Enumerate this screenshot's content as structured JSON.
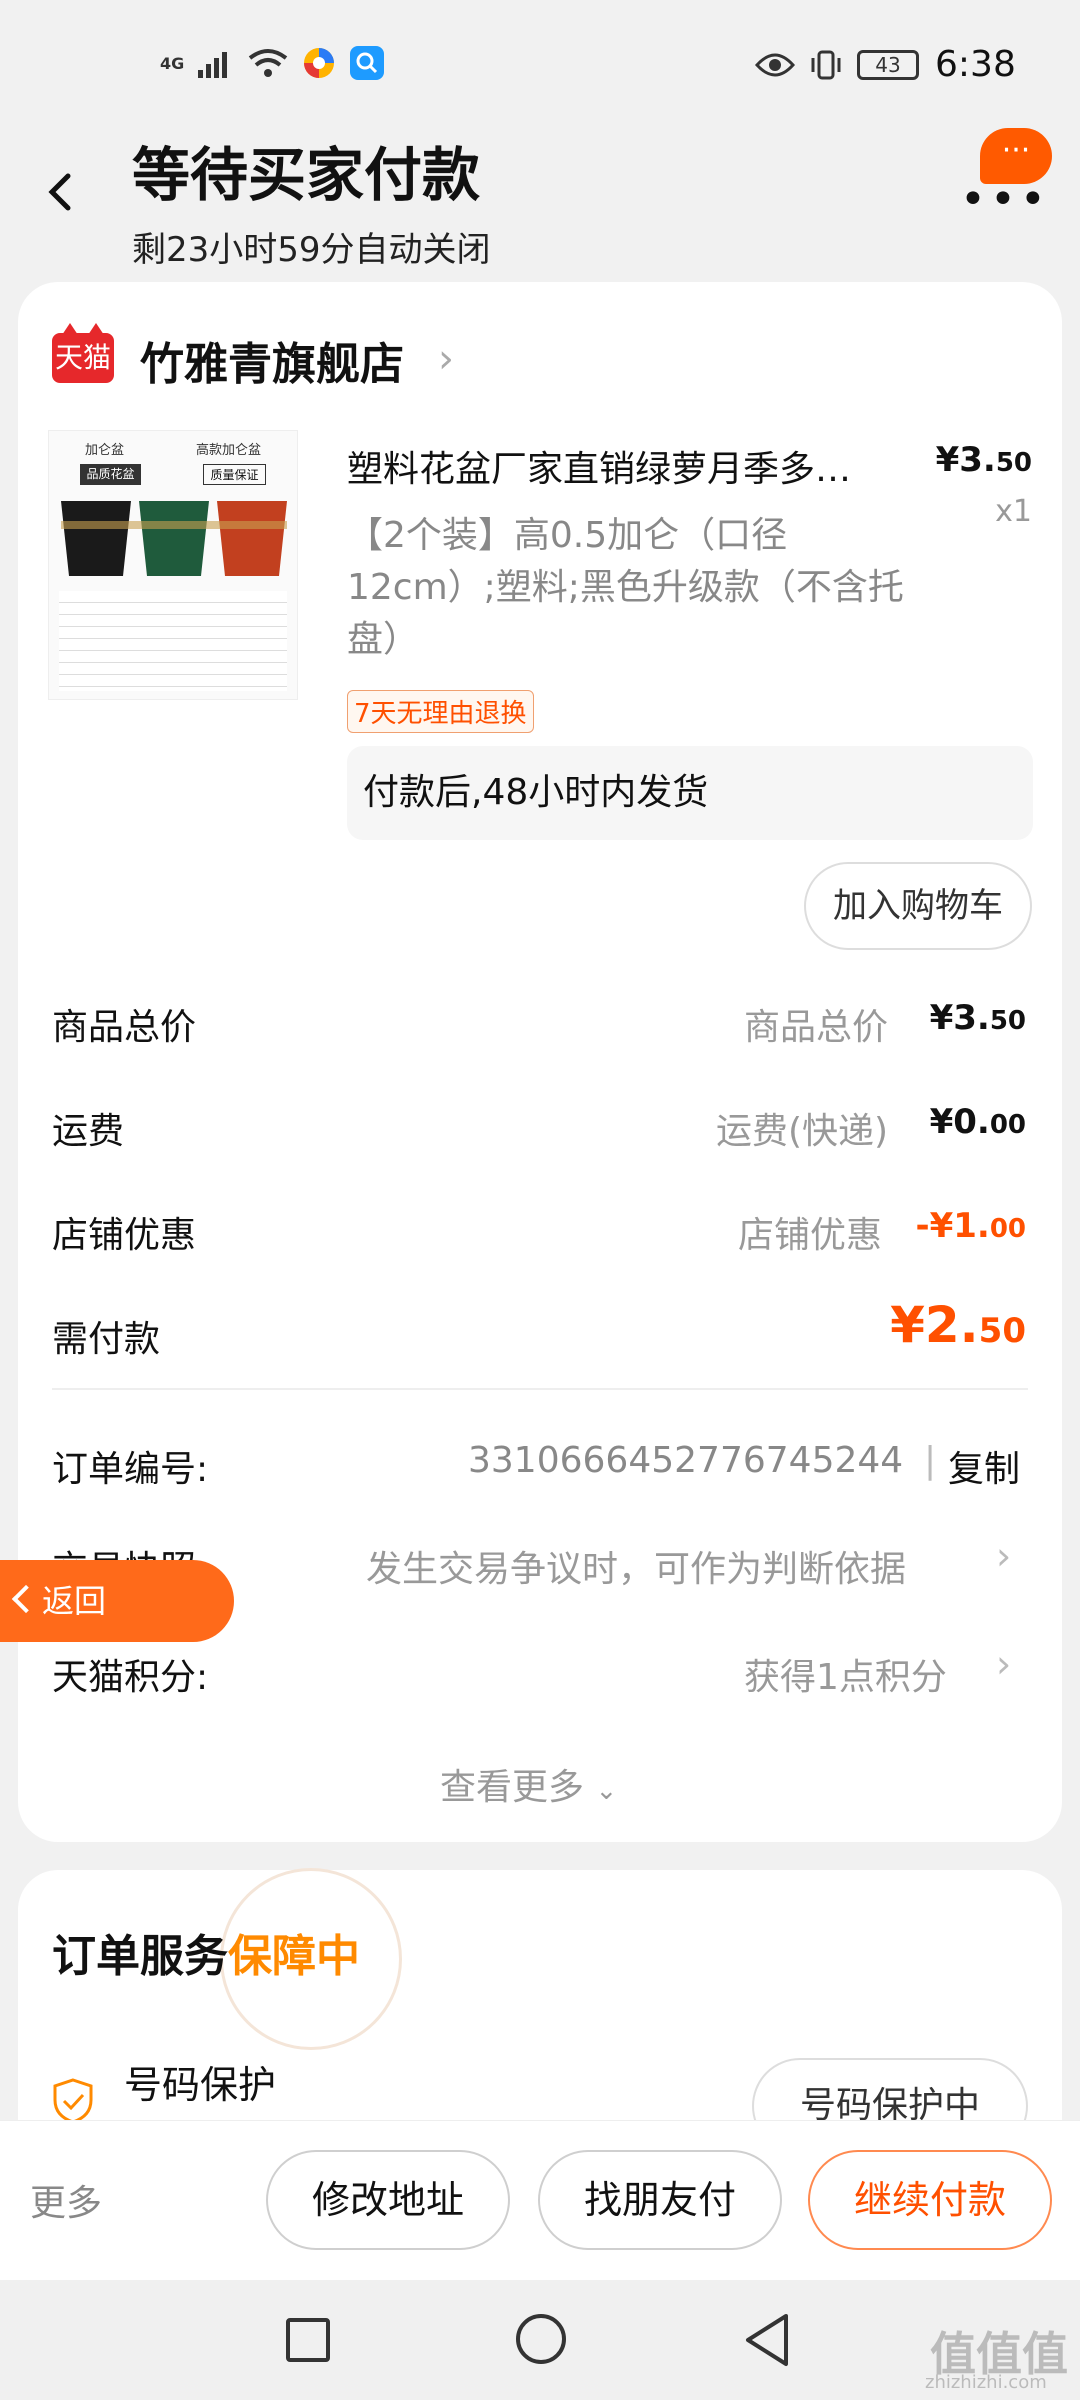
{
  "status_bar": {
    "time": "6:38",
    "battery": "43",
    "network": "4G"
  },
  "header": {
    "title": "等待买家付款",
    "subtitle": "剩23小时59分自动关闭",
    "chat_badge": "···",
    "more_label": "•••"
  },
  "shop": {
    "logo_text": "天猫",
    "name": "竹雅青旗舰店"
  },
  "product": {
    "title": "塑料花盆厂家直销绿萝月季多…",
    "price_main": "¥3.",
    "price_cents": "50",
    "quantity": "x1",
    "sku": "【2个装】高0.5加仑（口径12cm）;塑料;黑色升级款（不含托盘）",
    "tag": "7天无理由退换",
    "shipping_note": "付款后,48小时内发货",
    "add_to_cart": "加入购物车",
    "thumb_header": [
      "加仑盆",
      "高款加仑盆"
    ],
    "thumb_sub": [
      "品质花盆",
      "质量保证"
    ]
  },
  "summary": [
    {
      "label": "商品总价",
      "mid": "商品总价",
      "main": "¥3.",
      "cents": "50"
    },
    {
      "label": "运费",
      "mid": "运费(快递)",
      "main": "¥0.",
      "cents": "00"
    },
    {
      "label": "店铺优惠",
      "mid": "店铺优惠",
      "main": "-¥1.",
      "cents": "00"
    },
    {
      "label": "需付款",
      "mid": "",
      "main": "¥2.",
      "cents": "50"
    }
  ],
  "order_info": {
    "number_label": "订单编号:",
    "number_value": "3310666452776745244",
    "copy_label": "复制",
    "snapshot_label": "交易快照",
    "snapshot_value": "发生交易争议时，可作为判断依据",
    "points_label": "天猫积分:",
    "points_value": "获得1点积分",
    "see_more": "查看更多"
  },
  "return_button": "返回",
  "service": {
    "title": "订单服务",
    "title_highlight": "保障中",
    "item_label": "号码保护",
    "item_button": "号码保护中"
  },
  "actions": {
    "more": "更多",
    "modify_address": "修改地址",
    "friend_pay": "找朋友付",
    "continue_pay": "继续付款"
  },
  "watermark": {
    "main": "值值值",
    "sub": "zhizhizhi.com"
  },
  "colors": {
    "accent": "#ff5000",
    "tmall_red": "#e6282b",
    "bg": "#f1f1f1"
  }
}
